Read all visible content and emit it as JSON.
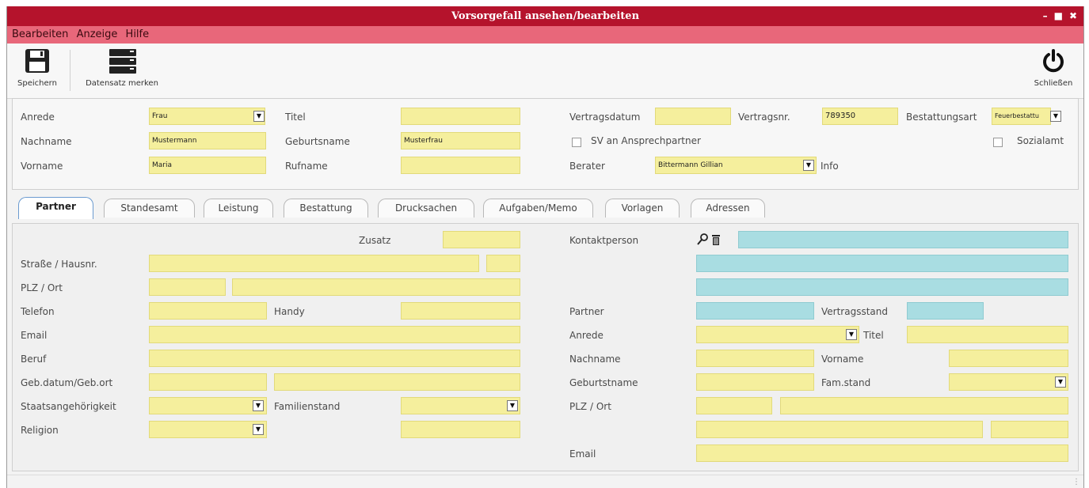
{
  "window": {
    "title": "Vorsorgefall ansehen/bearbeiten",
    "controls": [
      "–",
      "■",
      "✖"
    ]
  },
  "menu": [
    "Bearbeiten",
    "Anzeige",
    "Hilfe"
  ],
  "toolbar": {
    "save_label": "Speichern",
    "bookmark_label": "Datensatz merken",
    "close_label": "Schließen"
  },
  "header": {
    "anrede_label": "Anrede",
    "anrede_value": "Frau",
    "titel_label": "Titel",
    "titel_value": "",
    "nachname_label": "Nachname",
    "nachname_value": "Mustermann",
    "geburtsname_label": "Geburtsname",
    "geburtsname_value": "Musterfrau",
    "vorname_label": "Vorname",
    "vorname_value": "Maria",
    "rufname_label": "Rufname",
    "rufname_value": "",
    "vertragsdatum_label": "Vertragsdatum",
    "vertragsdatum_value": "",
    "vertragsnr_label": "Vertragsnr.",
    "vertragsnr_value": "789350",
    "bestattungsart_label": "Bestattungsart",
    "bestattungsart_value": "Feuerbestattu",
    "sv_label": "SV an Ansprechpartner",
    "sozialamt_label": "Sozialamt",
    "berater_label": "Berater",
    "berater_value": "Bittermann Gillian",
    "info_label": "Info"
  },
  "tabs": [
    "Partner",
    "Standesamt",
    "Leistung",
    "Bestattung",
    "Drucksachen",
    "Aufgaben/Memo",
    "Vorlagen",
    "Adressen"
  ],
  "partner_left": {
    "zusatz_label": "Zusatz",
    "strasse_label": "Straße / Hausnr.",
    "plz_label": "PLZ / Ort",
    "telefon_label": "Telefon",
    "handy_label": "Handy",
    "email_label": "Email",
    "beruf_label": "Beruf",
    "gebdatum_label": "Geb.datum/Geb.ort",
    "staat_label": "Staatsangehörigkeit",
    "familienstand_label": "Familienstand",
    "religion_label": "Religion"
  },
  "partner_right": {
    "kontaktperson_label": "Kontaktperson",
    "partner_label": "Partner",
    "vertragsstand_label": "Vertragsstand",
    "anrede_label": "Anrede",
    "titel_label": "Titel",
    "nachname_label": "Nachname",
    "vorname_label": "Vorname",
    "geburtsname_label": "Geburtstname",
    "famstand_label": "Fam.stand",
    "plz_label": "PLZ / Ort",
    "email_label": "Email"
  },
  "colors": {
    "titlebar": "#b5132c",
    "menubar": "#e8677a",
    "field_yellow": "#f5ef9d",
    "field_blue": "#a9dde2"
  }
}
